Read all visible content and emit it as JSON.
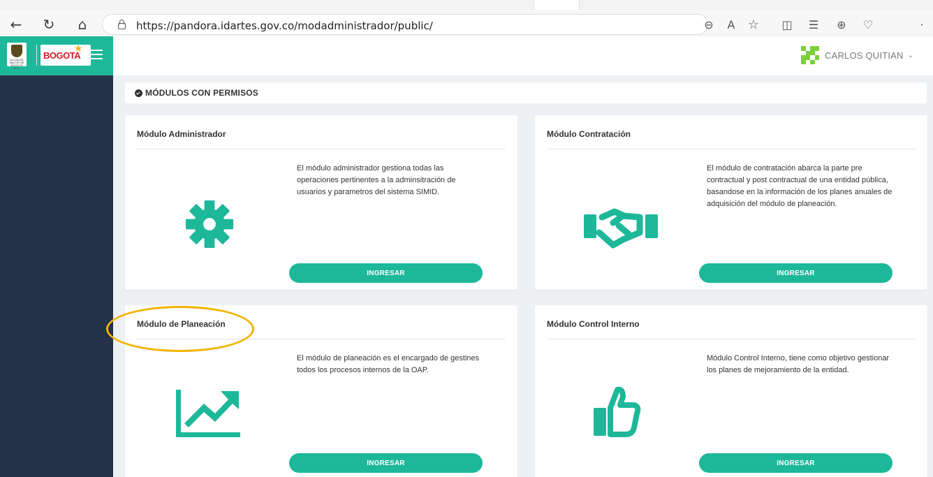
{
  "browser": {
    "url": "https://pandora.idartes.gov.co/modadministrador/public/",
    "back_glyph": "←",
    "reload_glyph": "↻",
    "home_glyph": "⌂",
    "toolbar_glyphs": {
      "zoom": "⊖",
      "read_aloud": "A",
      "favorite": "☆",
      "split": "◫",
      "favorites_bar": "☰",
      "collections": "⊕",
      "health": "♡",
      "more": "·"
    }
  },
  "header": {
    "escudo_caption": "ALCALDÍA MAYOR DE BOGOTÁ D.C.",
    "brand_word": "BOGOTA",
    "user_name": "CARLOS QUITIAN",
    "caret": "⌄"
  },
  "colors": {
    "accent": "#1db89a",
    "sidebar": "#24324a",
    "highlight": "#f2b400",
    "avatar_a": "#7bd13c",
    "avatar_b": "#ffffff"
  },
  "main": {
    "section_title": "MÓDULOS CON PERMISOS",
    "modules": [
      {
        "title": "Módulo Administrador",
        "description": "El módulo administrador gestiona todas las operaciones pertinentes a la adminsitración de usuarios y parametros del sistema SIMID.",
        "icon": "gear-icon",
        "button_label": "INGRESAR"
      },
      {
        "title": "Módulo Contratación",
        "description": "El módulo de contratación abarca la parte pre contractual y post contractual de una entidad pública, basandose en la información de los planes anuales de adquisición del módulo de planeación.",
        "icon": "handshake-icon",
        "button_label": "INGRESAR"
      },
      {
        "title": "Módulo de Planeación",
        "description": "El módulo de planeación es el encargado de gestines todos los procesos internos de la OAP.",
        "icon": "trend-chart-icon",
        "button_label": "INGRESAR"
      },
      {
        "title": "Módulo Control Interno",
        "description": "Módulo Control Interno, tiene como objetivo gestionar los planes de mejoramiento de la entidad.",
        "icon": "thumbs-up-icon",
        "button_label": "INGRESAR"
      }
    ]
  }
}
